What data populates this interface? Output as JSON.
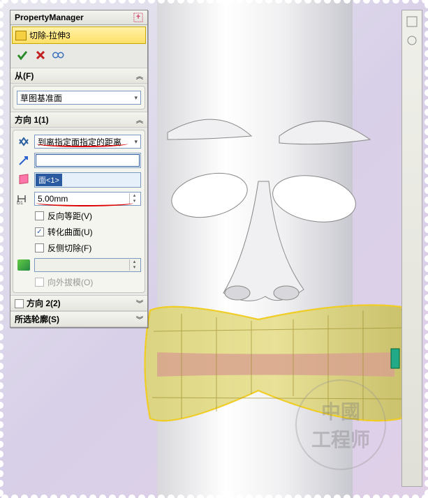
{
  "panel": {
    "title": "PropertyManager",
    "feature_name": "切除-拉伸3",
    "actions": {
      "ok": "ok",
      "cancel": "cancel",
      "detail": "detail"
    }
  },
  "sections": {
    "from": {
      "title": "从(F)",
      "value": "草图基准面"
    },
    "dir1": {
      "title": "方向 1(1)",
      "end_condition": "到离指定面指定的距离",
      "direction_field": "",
      "face_field": "面<1>",
      "distance": "5.00mm",
      "reverse_offset": {
        "label": "反向等距(V)",
        "checked": false
      },
      "translate_surface": {
        "label": "转化曲面(U)",
        "checked": true
      },
      "flip_cut": {
        "label": "反侧切除(F)",
        "checked": false
      },
      "draft_outward": {
        "label": "向外拔模(O)",
        "enabled": false
      }
    },
    "dir2": {
      "title": "方向 2(2)"
    },
    "contours": {
      "title": "所选轮廓(S)"
    }
  },
  "watermark": {
    "line1": "中國",
    "line2": "工程师"
  }
}
